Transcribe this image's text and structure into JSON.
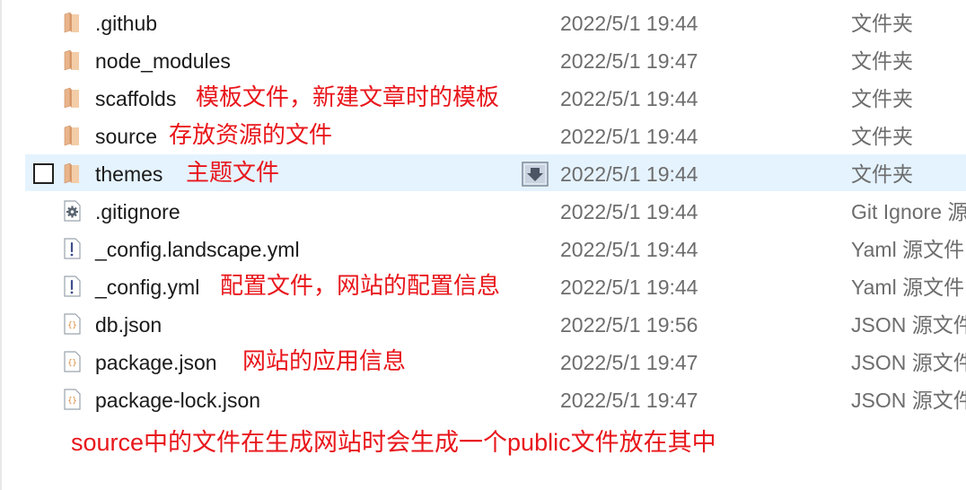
{
  "files": [
    {
      "name": ".github",
      "date": "2022/5/1 19:44",
      "type": "文件夹",
      "icon": "folder-icon",
      "note": ""
    },
    {
      "name": "node_modules",
      "date": "2022/5/1 19:47",
      "type": "文件夹",
      "icon": "folder-icon",
      "note": ""
    },
    {
      "name": "scaffolds",
      "date": "2022/5/1 19:44",
      "type": "文件夹",
      "icon": "folder-icon",
      "note": "模板文件，新建文章时的模板"
    },
    {
      "name": "source",
      "date": "2022/5/1 19:44",
      "type": "文件夹",
      "icon": "folder-icon",
      "note": "存放资源的文件"
    },
    {
      "name": "themes",
      "date": "2022/5/1 19:44",
      "type": "文件夹",
      "icon": "folder-icon",
      "note": "主题文件",
      "selected": true
    },
    {
      "name": ".gitignore",
      "date": "2022/5/1 19:44",
      "type": "Git Ignore 源",
      "icon": "gear-file-icon",
      "note": ""
    },
    {
      "name": "_config.landscape.yml",
      "date": "2022/5/1 19:44",
      "type": "Yaml 源文件",
      "icon": "exclamation-file-icon",
      "note": ""
    },
    {
      "name": "_config.yml",
      "date": "2022/5/1 19:44",
      "type": "Yaml 源文件",
      "icon": "exclamation-file-icon",
      "note": "配置文件，网站的配置信息"
    },
    {
      "name": "db.json",
      "date": "2022/5/1 19:56",
      "type": "JSON 源文件",
      "icon": "json-file-icon",
      "note": ""
    },
    {
      "name": "package.json",
      "date": "2022/5/1 19:47",
      "type": "JSON 源文件",
      "icon": "json-file-icon",
      "note": "网站的应用信息"
    },
    {
      "name": "package-lock.json",
      "date": "2022/5/1 19:47",
      "type": "JSON 源文件",
      "icon": "json-file-icon",
      "note": ""
    }
  ],
  "footer_note": "source中的文件在生成网站时会生成一个public文件放在其中",
  "colors": {
    "annotation": "#e8161b",
    "selection": "#e5f3ff",
    "folder": "#e9b48a"
  }
}
